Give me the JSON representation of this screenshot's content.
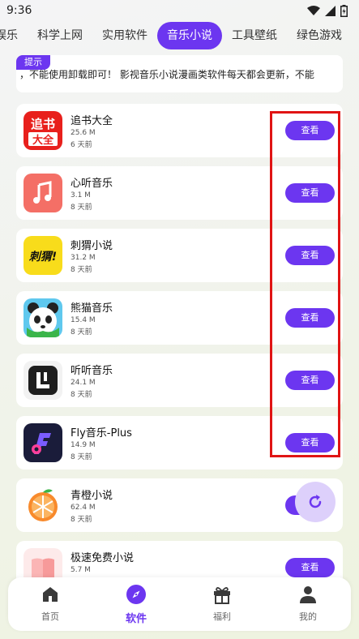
{
  "status": {
    "time": "9:36"
  },
  "tabs": [
    {
      "label": "娱乐",
      "active": false
    },
    {
      "label": "科学上网",
      "active": false
    },
    {
      "label": "实用软件",
      "active": false
    },
    {
      "label": "音乐小说",
      "active": true
    },
    {
      "label": "工具壁纸",
      "active": false
    },
    {
      "label": "绿色游戏",
      "active": false
    }
  ],
  "notice": {
    "tag": "提示",
    "text": "，不能使用卸载即可！  影视音乐小说漫画类软件每天都会更新，不能"
  },
  "apps": [
    {
      "name": "追书大全",
      "size": "25.6 M",
      "date": "6 天前",
      "button": "查看",
      "icon": "zhuishu-icon"
    },
    {
      "name": "心听音乐",
      "size": "3.1 M",
      "date": "8 天前",
      "button": "查看",
      "icon": "music-note-icon"
    },
    {
      "name": "刺猬小说",
      "size": "31.2 M",
      "date": "8 天前",
      "button": "查看",
      "icon": "ciwei-icon"
    },
    {
      "name": "熊猫音乐",
      "size": "15.4 M",
      "date": "8 天前",
      "button": "查看",
      "icon": "panda-icon"
    },
    {
      "name": "听听音乐",
      "size": "24.1 M",
      "date": "8 天前",
      "button": "查看",
      "icon": "tingting-icon"
    },
    {
      "name": "Fly音乐-Plus",
      "size": "14.9 M",
      "date": "8 天前",
      "button": "查看",
      "icon": "fly-icon"
    },
    {
      "name": "青橙小说",
      "size": "62.4 M",
      "date": "8 天前",
      "button": "查看",
      "icon": "orange-icon"
    },
    {
      "name": "极速免费小说",
      "size": "5.7 M",
      "date": "",
      "button": "查看",
      "icon": "book-icon"
    }
  ],
  "bottom_nav": [
    {
      "label": "首页",
      "icon": "home-icon",
      "active": false
    },
    {
      "label": "软件",
      "icon": "compass-icon",
      "active": true
    },
    {
      "label": "福利",
      "icon": "gift-icon",
      "active": false
    },
    {
      "label": "我的",
      "icon": "user-icon",
      "active": false
    }
  ],
  "colors": {
    "accent": "#6c36f0",
    "highlight": "#e01414"
  },
  "icon_glyphs": {
    "zhuishu_line1": "追书",
    "zhuishu_line2": "大全",
    "ciwei": "刺猬!"
  }
}
